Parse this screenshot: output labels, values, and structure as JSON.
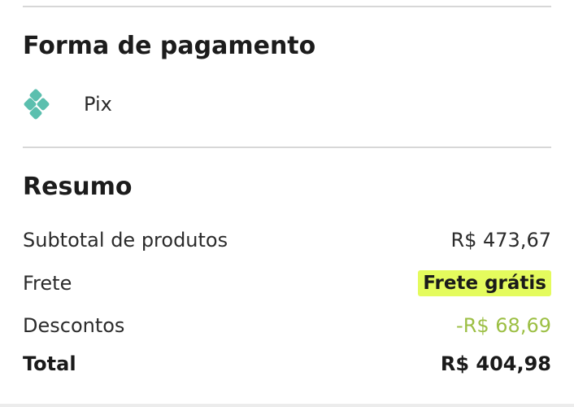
{
  "payment": {
    "title": "Forma de pagamento",
    "method_label": "Pix",
    "icon": "pix-icon",
    "icon_color": "#5bbfae"
  },
  "summary": {
    "title": "Resumo",
    "rows": {
      "subtotal": {
        "label": "Subtotal de produtos",
        "value": "R$ 473,67"
      },
      "frete": {
        "label": "Frete",
        "value": "Frete grátis"
      },
      "descontos": {
        "label": "Descontos",
        "value": "-R$ 68,69"
      },
      "total": {
        "label": "Total",
        "value": "R$ 404,98"
      }
    }
  },
  "colors": {
    "free_shipping_highlight": "#e4fb5d",
    "discount": "#9cbf44",
    "divider": "#d7d7d7"
  }
}
